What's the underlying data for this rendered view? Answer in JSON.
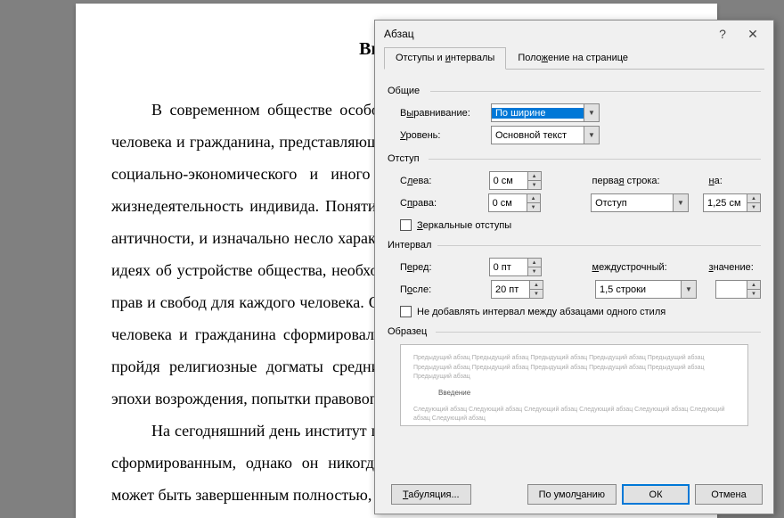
{
  "document": {
    "title": "Введение",
    "para1": "В современном обществе особое место занимает институт прав и свобод человека и гражданина, представляющий собой систему норм личного, правового, социально-экономического и иного характера, обеспечивающие нормальную жизнедеятельность индивида. Понятие прав человека появилось еще во времена античности, и изначально несло характер о морально-нравственных и социальных идеях об устройстве общества, необходимости защиты этих прав, и о пользе этих прав и свобод для каждого человека. Однако окончательно институт прав и свобод человека и гражданина сформировался только в эпоху Позднего средневековья, пройдя религиозные догматы средних веков, научные и творческие открытия эпохи возрождения, попытки правового обоснования в Новейшее время.",
    "para2": "На сегодняшний день институт прав и свобод человека считается полностью сформированным, однако он никогда с философско-научной точки зрения не может быть завершенным полностью, так как права и свободы"
  },
  "dialog": {
    "title": "Абзац",
    "tabs": {
      "indent": "Отступы и интервалы",
      "position": "Положение на странице"
    },
    "groups": {
      "general": "Общие",
      "indent": "Отступ",
      "interval": "Интервал",
      "sample": "Образец"
    },
    "labels": {
      "alignment": "Выравнивание:",
      "level": "Уровень:",
      "left": "Слева:",
      "right": "Справа:",
      "firstLine": "первая строка:",
      "by": "на:",
      "mirror": "Зеркальные отступы",
      "before": "Перед:",
      "after": "После:",
      "lineSpacing": "междустрочный:",
      "value": "значение:",
      "noAdd": "Не добавлять интервал между абзацами одного стиля"
    },
    "values": {
      "alignment": "По ширине",
      "level": "Основной текст",
      "left": "0 см",
      "right": "0 см",
      "firstLine": "Отступ",
      "by": "1,25 см",
      "before": "0 пт",
      "after": "20 пт",
      "lineSpacing": "1,5 строки",
      "value": ""
    },
    "sample": {
      "prev": "Предыдущий абзац Предыдущий абзац Предыдущий абзац Предыдущий абзац Предыдущий абзац Предыдущий абзац Предыдущий абзац Предыдущий абзац Предыдущий абзац Предыдущий абзац Предыдущий абзац",
      "center": "Введение",
      "next": "Следующий абзац Следующий абзац Следующий абзац Следующий абзац Следующий абзац Следующий абзац Следующий абзац"
    },
    "buttons": {
      "tabs": "Табуляция...",
      "default": "По умолчанию",
      "ok": "ОК",
      "cancel": "Отмена"
    }
  }
}
